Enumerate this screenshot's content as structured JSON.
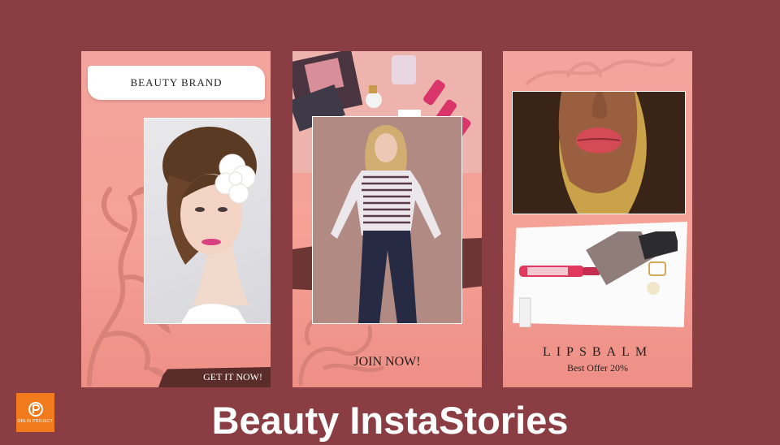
{
  "page": {
    "title": "Beauty InstaStories",
    "logo_text": "ORLIN PROJECT"
  },
  "cards": [
    {
      "badge": "BEAUTY BRAND",
      "cta": "GET IT NOW!"
    },
    {
      "cta": "JOIN NOW!"
    },
    {
      "title": "LIPSBALM",
      "offer": "Best Offer 20%"
    }
  ],
  "colors": {
    "background": "#8b3d44",
    "card_pink": "#f3a49c",
    "dark_brush": "#5a2c2a",
    "logo_orange": "#f07a1c",
    "title_text": "#ffffff"
  },
  "icons": [
    "floral-swirl-icon",
    "orlin-logo-icon"
  ]
}
